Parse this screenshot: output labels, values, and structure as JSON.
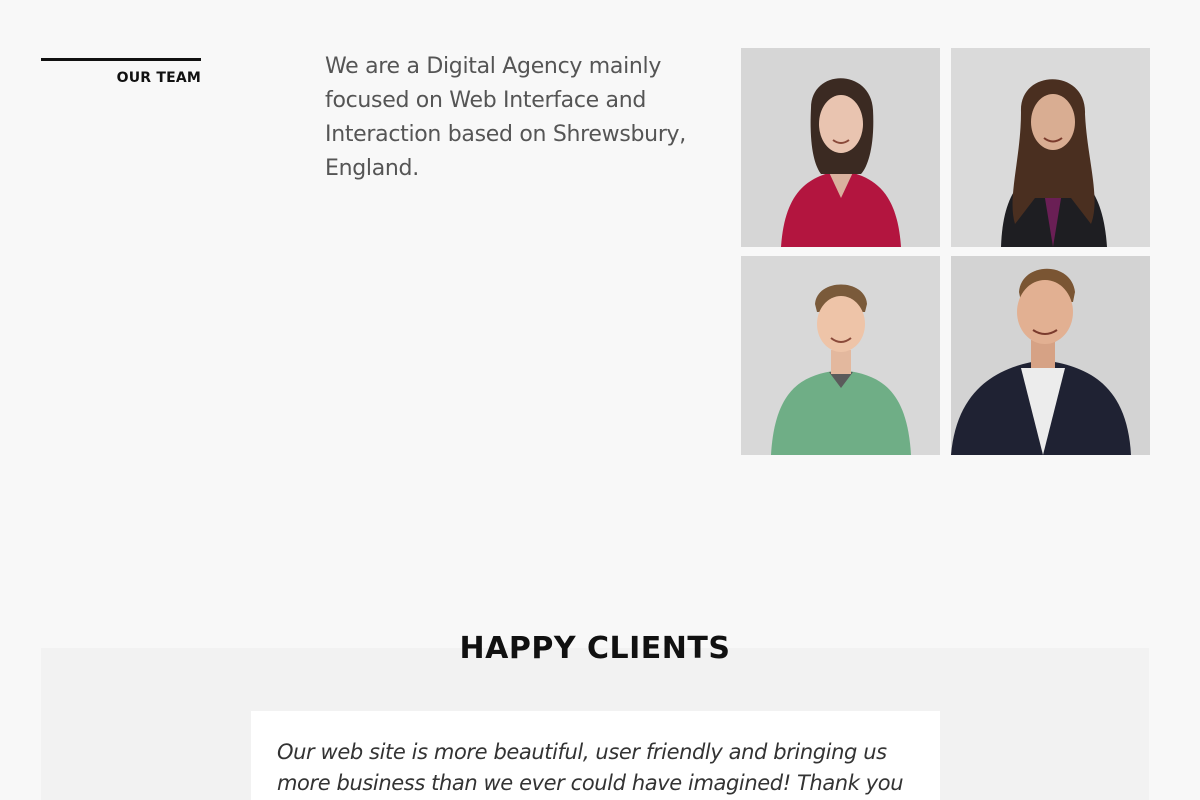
{
  "team": {
    "label": "OUR TEAM",
    "intro": "We are a Digital Agency mainly focused on Web Interface and Interaction based on Shrewsbury, England."
  },
  "clients": {
    "title": "HAPPY CLIENTS",
    "testimonial": "Our web site is more beautiful, user friendly and bringing us more business than we ever could have imagined! Thank you for all your"
  },
  "colors": {
    "page_bg": "#f8f8f8",
    "band_bg": "#f2f2f2",
    "text_dark": "#111111",
    "text_body": "#555555"
  }
}
